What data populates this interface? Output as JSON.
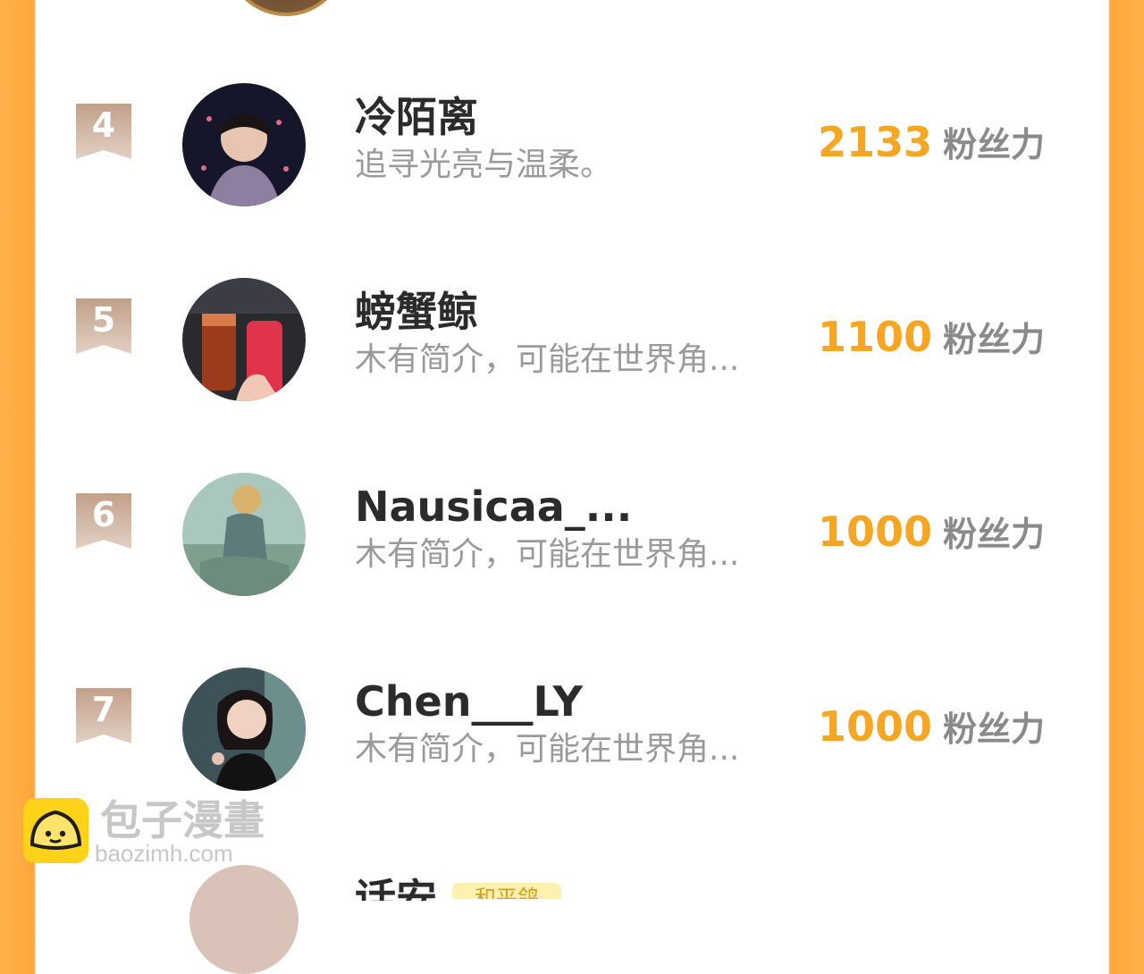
{
  "leaderboard": {
    "unit_label": "粉丝力",
    "rows": [
      {
        "rank": "4",
        "name": "冷陌离",
        "bio": "追寻光亮与温柔。",
        "score": "2133"
      },
      {
        "rank": "5",
        "name": "螃蟹鲸",
        "bio": "木有简介，可能在世界角...",
        "score": "1100"
      },
      {
        "rank": "6",
        "name": "Nausicaa_...",
        "bio": "木有简介，可能在世界角...",
        "score": "1000"
      },
      {
        "rank": "7",
        "name": "Chen___LY",
        "bio": "木有简介，可能在世界角...",
        "score": "1000"
      }
    ],
    "partial_next": {
      "name": "话安",
      "badge": "和平鸽"
    }
  },
  "watermark": {
    "title": "包子漫畫",
    "subtitle": "baozimh.com"
  },
  "colors": {
    "accent_orange": "#f5a623",
    "frame_orange": "#ffa63a",
    "rank_ribbon": "#c9ab98"
  },
  "icons": {
    "rank": "ribbon-icon",
    "logo": "bun-face-logo"
  }
}
